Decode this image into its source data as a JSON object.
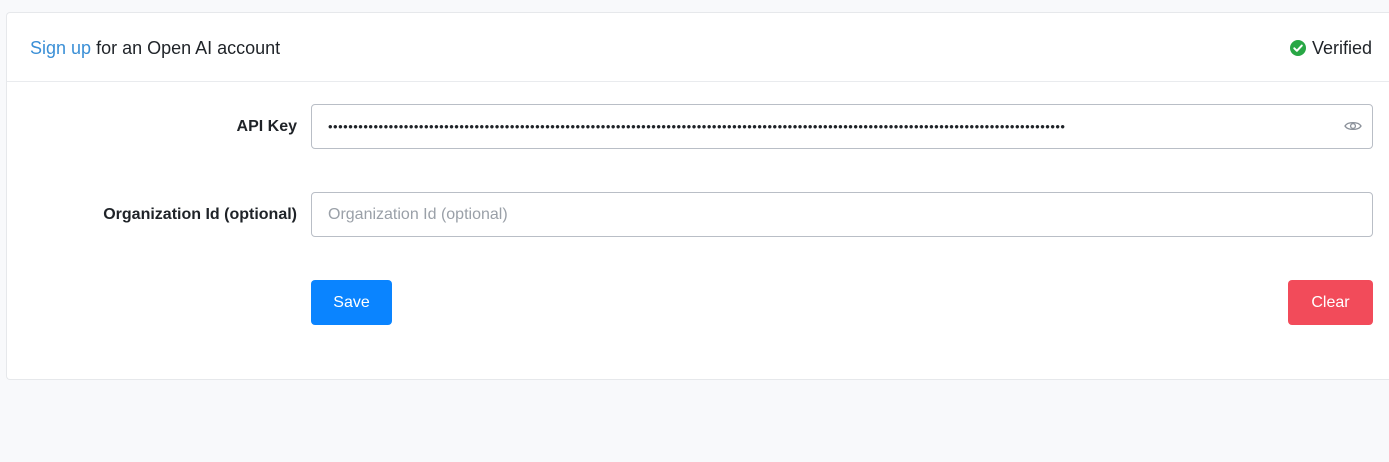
{
  "header": {
    "signup_link": "Sign up",
    "signup_rest": " for an Open AI account",
    "status_text": "Verified",
    "status_icon": "check-circle-icon",
    "status_color": "#28a745"
  },
  "form": {
    "api_key_label": "API Key",
    "api_key_value": "••••••••••••••••••••••••••••••••••••••••••••••••••••••••••••••••••••••••••••••••••••••••••••••••••••••••••••••••••••••••••••••••••••••••••••••••••",
    "api_key_toggle_icon": "eye-icon",
    "org_label": "Organization Id (optional)",
    "org_value": "",
    "org_placeholder": "Organization Id (optional)"
  },
  "actions": {
    "save_label": "Save",
    "clear_label": "Clear",
    "save_color": "#0a84ff",
    "clear_color": "#f24b5a"
  }
}
